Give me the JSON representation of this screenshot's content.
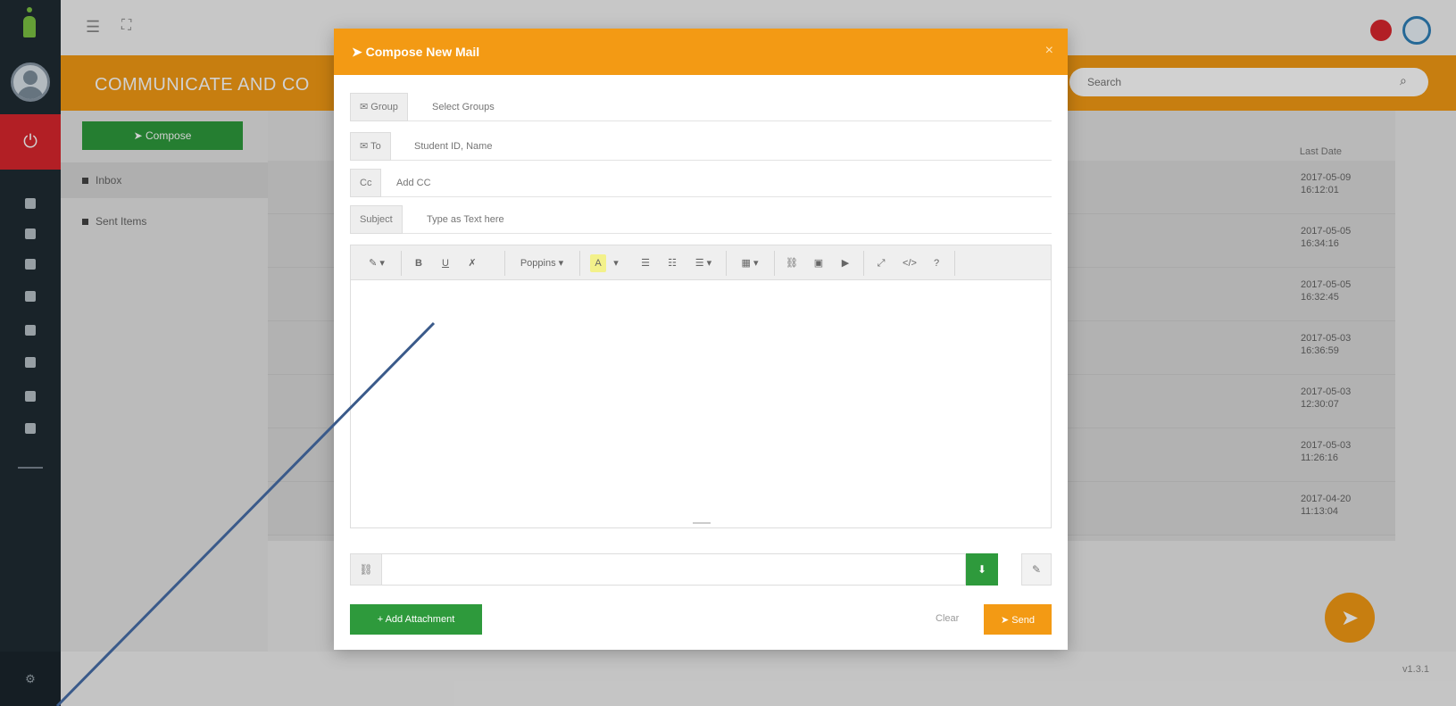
{
  "topbar": {
    "menu_icon": "☰",
    "expand_icon": "⛶"
  },
  "page_header": {
    "title": "COMMUNICATE AND CO",
    "search_placeholder": "Search"
  },
  "sidebar": {
    "compose_label": "➤ Compose",
    "folders": [
      {
        "label": "Inbox"
      },
      {
        "label": "Sent Items"
      }
    ]
  },
  "list": {
    "date_header": "Last Date",
    "rows": [
      {
        "date": "2017-05-09",
        "time": "16:12:01"
      },
      {
        "date": "2017-05-05",
        "time": "16:34:16"
      },
      {
        "date": "2017-05-05",
        "time": "16:32:45"
      },
      {
        "date": "2017-05-03",
        "time": "16:36:59"
      },
      {
        "date": "2017-05-03",
        "time": "12:30:07"
      },
      {
        "date": "2017-05-03",
        "time": "11:26:16"
      },
      {
        "date": "2017-04-20",
        "time": "11:13:04"
      }
    ]
  },
  "footer": {
    "version": "v1.3.1"
  },
  "modal": {
    "title": "➤ Compose New Mail",
    "close": "×",
    "group": {
      "label": "✉ Group",
      "placeholder": "Select Groups"
    },
    "to": {
      "label": "✉ To",
      "placeholder": "Student ID, Name"
    },
    "cc": {
      "label": "Cc",
      "placeholder": "Add CC"
    },
    "subject": {
      "label": "Subject",
      "placeholder": "Type as Text here"
    },
    "toolbar": {
      "style": "✎ ▾",
      "bold": "B",
      "underline": "U",
      "eraser": "✗",
      "font": "Poppins ▾",
      "color": "A",
      "color_caret": "▾",
      "ul": "☰",
      "ol": "☷",
      "align": "☰ ▾",
      "table": "▦ ▾",
      "link": "⛓",
      "picture": "▣",
      "video": "▶",
      "fullscreen": "⤢",
      "code": "</>",
      "help": "?"
    },
    "link_addon": "⛓",
    "download_icon": "⬇",
    "tool_icon": "✎",
    "attach_label": "+ Add Attachment",
    "clear_label": "Clear",
    "send_label": "➤ Send"
  },
  "fab_icon": "➤"
}
